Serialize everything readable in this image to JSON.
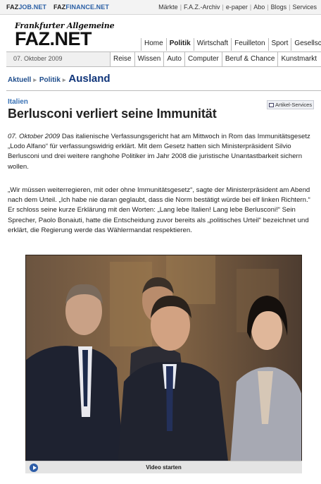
{
  "topbar": {
    "faz_job_prefix": "FAZ",
    "faz_job_suffix": "JOB.NET",
    "faz_finance_prefix": "FAZ",
    "faz_finance_suffix": "FINANCE.NET",
    "links": [
      "Märkte",
      "F.A.Z.-Archiv",
      "e-paper",
      "Abo",
      "Blogs",
      "Services"
    ]
  },
  "masthead": {
    "logo_top": "Frankfurter Allgemeine",
    "logo_main": "FAZ.NET",
    "date": "07. Oktober 2009",
    "nav_primary": [
      "Home",
      "Politik",
      "Wirtschaft",
      "Feuilleton",
      "Sport",
      "Gesellsc"
    ],
    "nav_primary_active": "Politik",
    "nav_secondary": [
      "Reise",
      "Wissen",
      "Auto",
      "Computer",
      "Beruf & Chance",
      "Kunstmarkt"
    ]
  },
  "breadcrumb": {
    "items": [
      "Aktuell",
      "Politik"
    ],
    "current": "Ausland"
  },
  "article": {
    "kicker": "Italien",
    "services_label": "Artikel-Services",
    "headline": "Berlusconi verliert seine Immunität",
    "dateline": "07. Oktober 2009",
    "para1": "Das italienische Verfassungsgericht hat am Mittwoch in Rom das Immunitätsgesetz „Lodo Alfano“ für verfassungswidrig erklärt. Mit dem Gesetz hatten sich Ministerpräsident Silvio Berlusconi und drei weitere ranghohe Politiker im Jahr 2008 die juristische Unantastbarkeit sichern wollen.",
    "para2": "„Wir müssen weiterregieren, mit oder ohne Immunitätsgesetz“, sagte der Ministerpräsident am Abend nach dem Urteil. „Ich habe nie daran geglaubt, dass die Norm bestätigt würde bei elf linken Richtern.“ Er schloss seine kurze Erklärung mit den Worten: „Lang lebe Italien! Lang lebe Berlusconi!“ Sein Sprecher, Paolo Bonaiuti, hatte die Entscheidung zuvor bereits als „politisches Urteil“ bezeichnet und erklärt, die Regierung werde das Wählermandat respektieren."
  },
  "video": {
    "start_label": "Video starten"
  }
}
